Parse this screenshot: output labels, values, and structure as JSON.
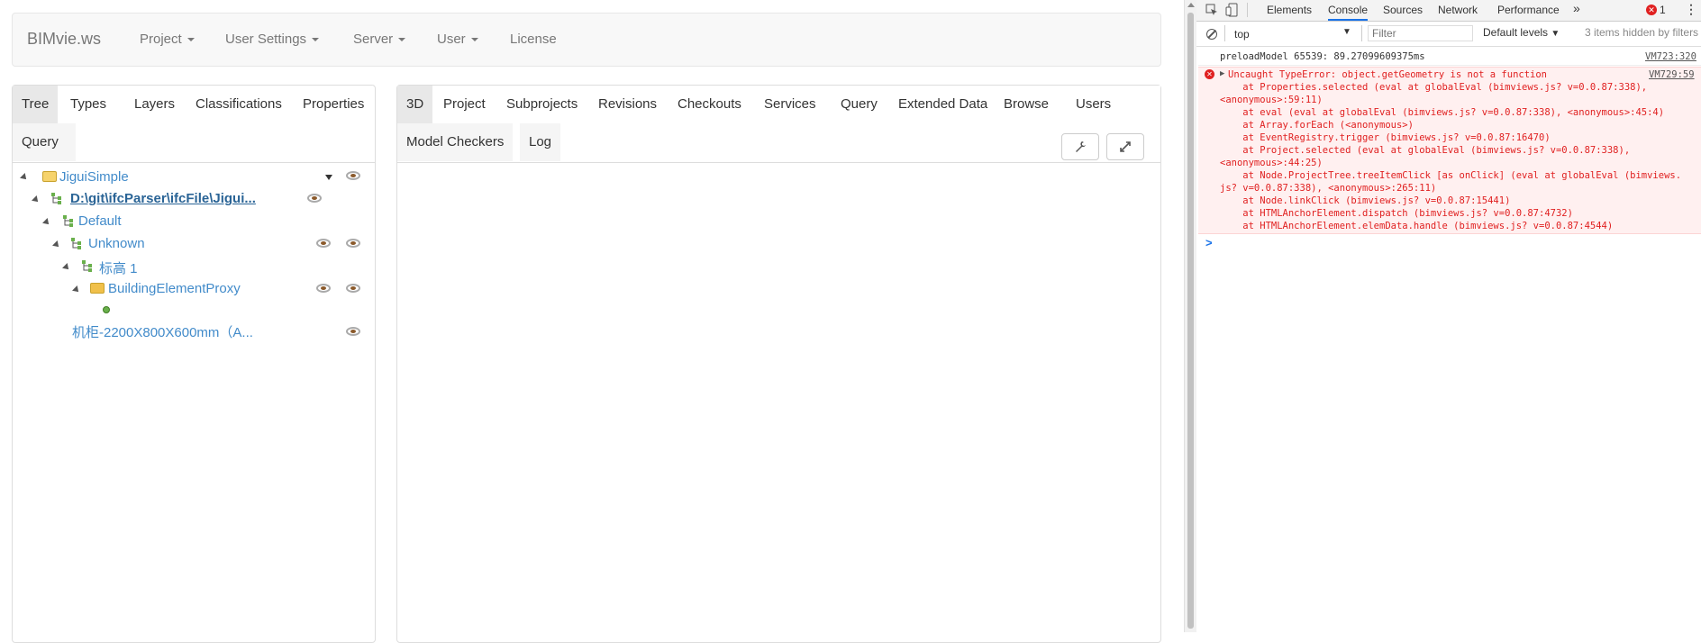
{
  "navbar": {
    "brand": "BIMvie.ws",
    "items": [
      {
        "label": "Project",
        "dropdown": true
      },
      {
        "label": "User Settings",
        "dropdown": true
      },
      {
        "label": "Server",
        "dropdown": true
      },
      {
        "label": "User",
        "dropdown": true
      },
      {
        "label": "License",
        "dropdown": false
      }
    ]
  },
  "left_tabs": [
    "Tree",
    "Types",
    "Layers",
    "Classifications",
    "Properties",
    "Query"
  ],
  "right_tabs": [
    "3D",
    "Project",
    "Subprojects",
    "Revisions",
    "Checkouts",
    "Services",
    "Query",
    "Extended Data",
    "Browse",
    "Users",
    "Model Checkers",
    "Log"
  ],
  "tree": [
    {
      "label": "JiguiSimple",
      "icon": "folder-icon"
    },
    {
      "label": "D:\\git\\ifcParser\\ifcFile\\Jigui...",
      "icon": "hierarchy-icon"
    },
    {
      "label": "Default",
      "icon": "hierarchy-icon"
    },
    {
      "label": "Unknown",
      "icon": "hierarchy-icon"
    },
    {
      "label": "标高 1",
      "icon": "hierarchy-icon"
    },
    {
      "label": "BuildingElementProxy",
      "icon": "folder-open-icon"
    },
    {
      "label": "",
      "icon": "green-dot-icon"
    },
    {
      "label": "机柜-2200X800X600mm（A...",
      "icon": "none"
    }
  ],
  "devtools": {
    "tabs": [
      "Elements",
      "Console",
      "Sources",
      "Network",
      "Performance"
    ],
    "active_tab": "Console",
    "error_count": "1",
    "context": "top",
    "filter_placeholder": "Filter",
    "levels": "Default levels",
    "hidden_note": "3 items hidden by filters",
    "log_line": "preloadModel 65539: 89.27099609375ms",
    "log_source": "VM723:320",
    "error_source": "VM729:59",
    "error_lines": [
      "Uncaught TypeError: object.getGeometry is not a function",
      "    at Properties.selected (eval at globalEval (bimviews.js? v=0.0.87:338),",
      "<anonymous>:59:11)",
      "    at eval (eval at globalEval (bimviews.js? v=0.0.87:338), <anonymous>:45:4)",
      "    at Array.forEach (<anonymous>)",
      "    at EventRegistry.trigger (bimviews.js? v=0.0.87:16470)",
      "    at Project.selected (eval at globalEval (bimviews.js? v=0.0.87:338),",
      "<anonymous>:44:25)",
      "    at Node.ProjectTree.treeItemClick [as onClick] (eval at globalEval (bimviews.",
      "js? v=0.0.87:338), <anonymous>:265:11)",
      "    at Node.linkClick (bimviews.js? v=0.0.87:15441)",
      "    at HTMLAnchorElement.dispatch (bimviews.js? v=0.0.87:4732)",
      "    at HTMLAnchorElement.elemData.handle (bimviews.js? v=0.0.87:4544)"
    ],
    "prompt": ">"
  },
  "colors": {
    "link": "#428bca",
    "error": "#e02020",
    "error_bg": "#fff0f0"
  }
}
